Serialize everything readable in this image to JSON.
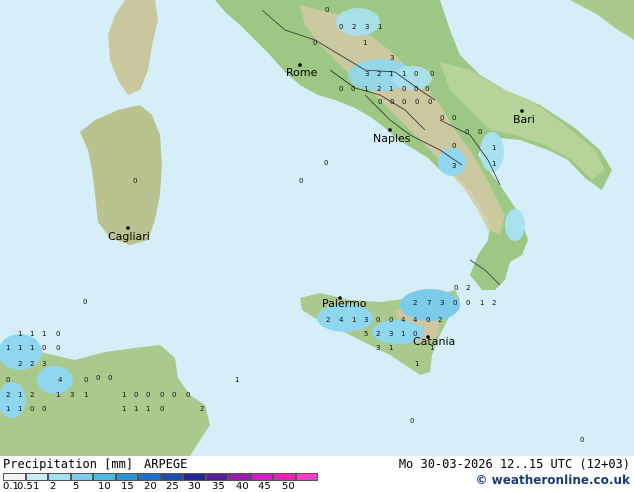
{
  "title": "Precipitation [mm]",
  "model": "ARPEGE",
  "datetime": "Mo 30-03-2026 12..15 UTC (12+03)",
  "credit": "© weatheronline.co.uk",
  "colors": {
    "sea": "#d6eef8",
    "land_low": "#9dc785",
    "land_high": "#d9ccaa",
    "precip_light": "#a8e2f0",
    "precip_mod": "#5fc7e6"
  },
  "cities": [
    {
      "name": "Rome"
    },
    {
      "name": "Bari"
    },
    {
      "name": "Naples"
    },
    {
      "name": "Cagliari"
    },
    {
      "name": "Palermo"
    },
    {
      "name": "Catania"
    }
  ],
  "legend": {
    "labels": [
      "0.1",
      "0.5",
      "1",
      "2",
      "5",
      "10",
      "15",
      "20",
      "25",
      "30",
      "35",
      "40",
      "45",
      "50"
    ],
    "colors": [
      "#f5f5f5",
      "#cdeef8",
      "#a6e1f3",
      "#7ad0ec",
      "#4cb8e4",
      "#2a96d8",
      "#1e70c8",
      "#1e4cb0",
      "#25289a",
      "#5a1e9a",
      "#9a1eb4",
      "#d21ec8",
      "#ee20b8",
      "#ff3cc8"
    ]
  },
  "values": {
    "apennines": [
      "0",
      "0",
      "2",
      "3",
      "1",
      "0",
      "1",
      "3",
      "3",
      "2",
      "1",
      "1",
      "0",
      "0",
      "0",
      "0",
      "1",
      "2",
      "1",
      "0",
      "0",
      "0",
      "0",
      "0"
    ],
    "campania": [
      "0",
      "0",
      "0",
      "0",
      "0",
      "0",
      "0",
      "0",
      "3",
      "1",
      "1"
    ],
    "sicily": [
      "2",
      "4",
      "1",
      "3",
      "0",
      "0",
      "4",
      "4",
      "0",
      "2",
      "2",
      "7",
      "3",
      "0",
      "0",
      "1",
      "0",
      "2",
      "2",
      "5",
      "2",
      "3",
      "1",
      "0",
      "3",
      "1",
      "1",
      "1"
    ],
    "tunisia": [
      "1",
      "1",
      "1",
      "0",
      "1",
      "1",
      "1",
      "0",
      "0",
      "2",
      "2",
      "3",
      "0",
      "4",
      "0",
      "2",
      "1",
      "2",
      "1",
      "3",
      "1",
      "0",
      "0",
      "1",
      "0",
      "0",
      "0",
      "0",
      "0",
      "1",
      "1",
      "0",
      "0",
      "1",
      "1",
      "1",
      "0",
      "2"
    ]
  }
}
